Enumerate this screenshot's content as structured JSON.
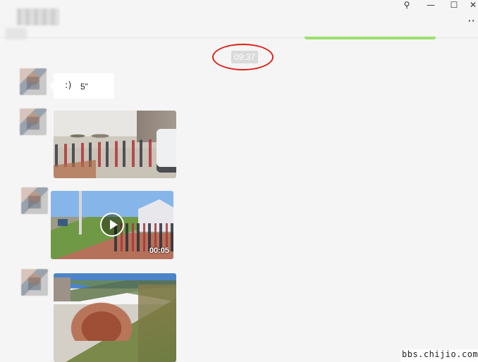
{
  "header": {
    "controls": [
      {
        "name": "pin-icon",
        "glyph": "⚲"
      },
      {
        "name": "minimize-icon",
        "glyph": "—"
      },
      {
        "name": "maximize-icon",
        "glyph": "☐"
      },
      {
        "name": "close-icon",
        "glyph": "✕"
      }
    ],
    "more_glyph": "··"
  },
  "chat": {
    "timestamp": "09:37",
    "annotation_color": "#d9231a",
    "messages": [
      {
        "type": "voice",
        "duration_label": "5\"",
        "icon": "voice-wave-icon",
        "icon_glyph": "🔊"
      },
      {
        "type": "image",
        "description_icon": "photo"
      },
      {
        "type": "video",
        "duration": "00:05"
      },
      {
        "type": "image",
        "description_icon": "photo"
      }
    ]
  },
  "watermark": "bbs.chijio.com",
  "colors": {
    "background": "#f5f5f5",
    "bubble": "#ffffff",
    "accent_green": "#9be06c",
    "timestamp_pill": "#dadada"
  }
}
